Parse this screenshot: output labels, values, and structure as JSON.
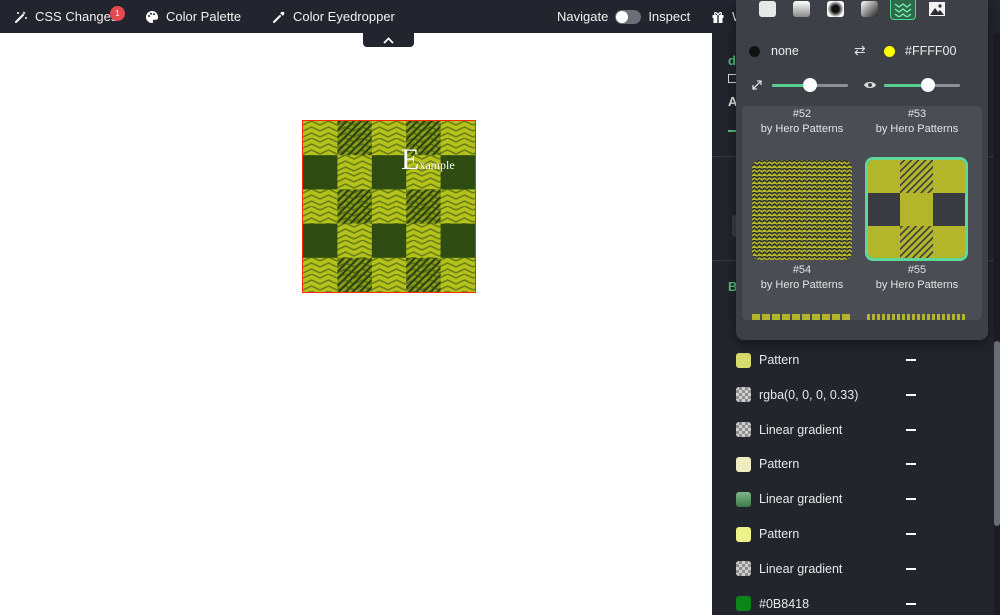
{
  "toolbar": {
    "css_changes": "CSS Changes",
    "css_changes_badge": "1",
    "color_palette": "Color Palette",
    "color_eyedropper": "Color Eyedropper",
    "navigate": "Navigate",
    "inspect": "Inspect",
    "partial_item": "W",
    "mode_toggle_state": "off"
  },
  "preview": {
    "text_big": "E",
    "text_small": "xample",
    "colors": {
      "light": "#b6c21c",
      "dark": "#2f4d12",
      "border": "#ff2a00"
    }
  },
  "panel_peek": {
    "letter_green": "d",
    "letter_a": "A",
    "letter_b": "B"
  },
  "popup": {
    "type_buttons": [
      {
        "name": "solid",
        "active": false
      },
      {
        "name": "linear-gradient",
        "active": false
      },
      {
        "name": "radial-gradient",
        "active": false
      },
      {
        "name": "conic-gradient",
        "active": false
      },
      {
        "name": "pattern",
        "active": true
      },
      {
        "name": "image",
        "active": false
      }
    ],
    "color_a": {
      "label": "none",
      "swatch": "#111111"
    },
    "swap_icon": "⇄",
    "color_b": {
      "label": "#FFFF00",
      "swatch": "#FFFF00"
    },
    "scale_value": 0.5,
    "opacity_value": 0.58,
    "patterns": [
      {
        "number": "#52",
        "author": "by Hero Patterns"
      },
      {
        "number": "#53",
        "author": "by Hero Patterns"
      },
      {
        "number": "#54",
        "author": "by Hero Patterns"
      },
      {
        "number": "#55",
        "author": "by Hero Patterns",
        "selected": true
      }
    ]
  },
  "layers": [
    {
      "label": "Pattern",
      "swatch": "pattern-yellow"
    },
    {
      "label": "rgba(0, 0, 0, 0.33)",
      "swatch": "checker"
    },
    {
      "label": "Linear gradient",
      "swatch": "checker"
    },
    {
      "label": "Pattern",
      "swatch": "pattern-light"
    },
    {
      "label": "Linear gradient",
      "swatch": "gradient-green"
    },
    {
      "label": "Pattern",
      "swatch": "pattern-yellow-light"
    },
    {
      "label": "Linear gradient",
      "swatch": "checker"
    },
    {
      "label": "#0B8418",
      "swatch": "#0B8418"
    }
  ]
}
